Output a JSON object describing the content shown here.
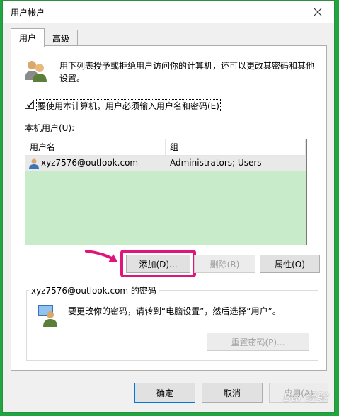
{
  "window": {
    "title": "用户帐户"
  },
  "tabs": [
    {
      "label": "用户"
    },
    {
      "label": "高级"
    }
  ],
  "intro_text_line1": "用下列表授予或拒绝用户访问你的计算机，还可以更改其密码和其他",
  "intro_text_line2": "设置。",
  "require_password": {
    "label": "要使用本计算机，用户必须输入用户名和密码(E)",
    "checked": true
  },
  "users_label": "本机用户(U):",
  "users_table": {
    "columns": [
      "用户名",
      "组"
    ],
    "rows": [
      {
        "username": "xyz7576@outlook.com",
        "group": "Administrators; Users"
      }
    ]
  },
  "buttons": {
    "add": "添加(D)...",
    "remove": "删除(R)",
    "properties": "属性(O)",
    "reset_password": "重置密码(P)...",
    "ok": "确定",
    "cancel": "取消",
    "apply": "应用(A)"
  },
  "password_group": {
    "title": "xyz7576@outlook.com 的密码",
    "text": "要更改你的密码，请转到“电脑设置”，然后选择“用户”。"
  },
  "watermark": "Bai 经验",
  "colors": {
    "desktop": "#1fa640",
    "list_bg": "#c8ebc9",
    "highlight": "#e0147a"
  }
}
